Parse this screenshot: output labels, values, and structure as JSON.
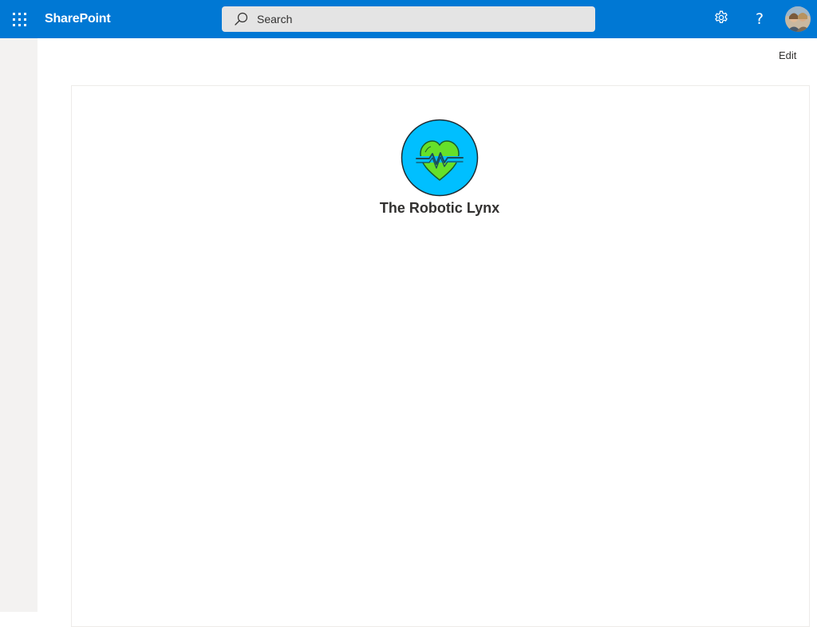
{
  "suite_bar": {
    "app_launcher_icon": "waffle-grid-icon",
    "brand": "SharePoint",
    "search": {
      "placeholder": "Search",
      "icon": "search-icon"
    },
    "settings_icon": "gear-icon",
    "help_glyph": "?",
    "avatar_icon": "user-avatar"
  },
  "command_bar": {
    "edit_label": "Edit"
  },
  "site": {
    "title": "The Robotic Lynx",
    "logo_icon": "heart-pulse-icon"
  },
  "colors": {
    "suite_bar": "#0078d4",
    "left_rail": "#f3f2f1",
    "logo_circle": "#00bfff",
    "logo_heart": "#66e02a"
  }
}
